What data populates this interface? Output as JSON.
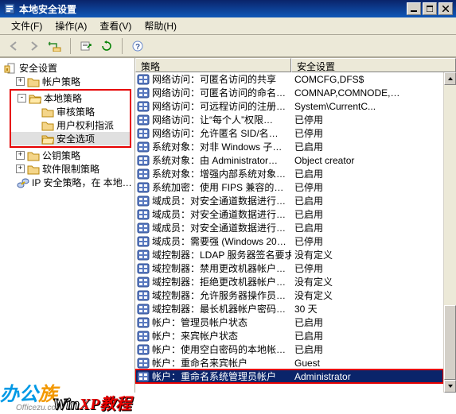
{
  "window": {
    "title": "本地安全设置"
  },
  "menu": {
    "file": "文件(F)",
    "action": "操作(A)",
    "view": "查看(V)",
    "help": "帮助(H)"
  },
  "tree": {
    "root": "安全设置",
    "account": "帐户策略",
    "local": "本地策略",
    "audit": "审核策略",
    "userrights": "用户权利指派",
    "secoptions": "安全选项",
    "pubkey": "公钥策略",
    "softrestrict": "软件限制策略",
    "ipsec": "IP 安全策略，在 本地…"
  },
  "listhead": {
    "c1": "策略",
    "c2": "安全设置"
  },
  "rows": [
    {
      "p": "网络访问：可匿名访问的共享",
      "v": "COMCFG,DFS$"
    },
    {
      "p": "网络访问：可匿名访问的命名…",
      "v": "COMNAP,COMNODE,…"
    },
    {
      "p": "网络访问：可远程访问的注册…",
      "v": "System\\CurrentC..."
    },
    {
      "p": "网络访问：让“每个人”权限…",
      "v": "已停用"
    },
    {
      "p": "网络访问：允许匿名 SID/名…",
      "v": "已停用"
    },
    {
      "p": "系统对象：对非 Windows 子…",
      "v": "已启用"
    },
    {
      "p": "系统对象：由 Administrator…",
      "v": "Object creator"
    },
    {
      "p": "系统对象：增强内部系统对象…",
      "v": "已启用"
    },
    {
      "p": "系统加密：使用 FIPS 兼容的…",
      "v": "已停用"
    },
    {
      "p": "域成员：对安全通道数据进行…",
      "v": "已启用"
    },
    {
      "p": "域成员：对安全通道数据进行…",
      "v": "已启用"
    },
    {
      "p": "域成员：对安全通道数据进行…",
      "v": "已启用"
    },
    {
      "p": "域成员：需要强 (Windows 20…",
      "v": "已停用"
    },
    {
      "p": "域控制器：LDAP 服务器签名要求",
      "v": "没有定义"
    },
    {
      "p": "域控制器：禁用更改机器帐户…",
      "v": "已停用"
    },
    {
      "p": "域控制器：拒绝更改机器帐户…",
      "v": "没有定义"
    },
    {
      "p": "域控制器：允许服务器操作员…",
      "v": "没有定义"
    },
    {
      "p": "域控制器：最长机器帐户密码…",
      "v": "30 天"
    },
    {
      "p": "帐户：管理员帐户状态",
      "v": "已启用"
    },
    {
      "p": "帐户：来宾帐户状态",
      "v": "已启用"
    },
    {
      "p": "帐户：使用空白密码的本地帐…",
      "v": "已启用"
    },
    {
      "p": "帐户：重命名来宾帐户",
      "v": "Guest"
    },
    {
      "p": "帐户：重命名系统管理员帐户",
      "v": "Administrator"
    }
  ],
  "watermark": {
    "brand1a": "办公",
    "brand1b": "族",
    "brand1url": "Officezu.com",
    "brand2a": "Win",
    "brand2b": "XP教程"
  }
}
